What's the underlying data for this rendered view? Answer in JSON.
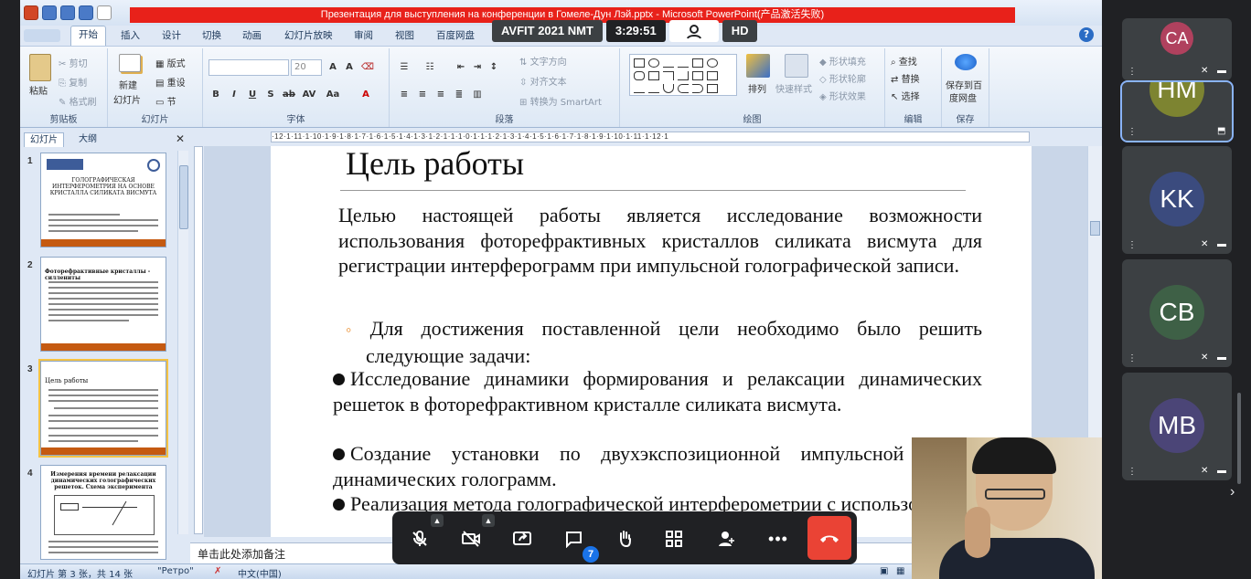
{
  "window": {
    "title": "Презентация для выступления на конференции в Гомеле-Дун Лэй.pptx - Microsoft PowerPoint(产品激活失败)"
  },
  "ribbon": {
    "tabs": [
      "开始",
      "插入",
      "设计",
      "切换",
      "动画",
      "幻灯片放映",
      "审阅",
      "视图",
      "百度网盘"
    ],
    "clipboard": {
      "paste": "粘贴",
      "cut": "剪切",
      "copy": "复制",
      "format_painter": "格式刷",
      "label": "剪贴板"
    },
    "slides": {
      "new_slide_1": "新建",
      "new_slide_2": "幻灯片",
      "layout": "版式",
      "reset": "重设",
      "section": "节",
      "label": "幻灯片"
    },
    "font": {
      "size": "20",
      "label": "字体"
    },
    "paragraph": {
      "text_direction": "文字方向",
      "align_text": "对齐文本",
      "smartart": "转换为 SmartArt",
      "label": "段落"
    },
    "drawing": {
      "arrange": "排列",
      "quick_styles": "快速样式",
      "shape_fill": "形状填充",
      "shape_outline": "形状轮廓",
      "shape_effects": "形状效果",
      "label": "绘图"
    },
    "editing": {
      "find": "查找",
      "replace": "替换",
      "select": "选择",
      "label": "编辑"
    },
    "save": {
      "save_1": "保存到百",
      "save_2": "度网盘",
      "label": "保存"
    }
  },
  "panel": {
    "tab_slides": "幻灯片",
    "tab_outline": "大纲",
    "thumbnails": [
      {
        "num": "1",
        "title": "ГОЛОГРАФИЧЕСКАЯ ИНТЕРФЕРОМЕТРИЯ НА ОСНОВЕ КРИСТАЛЛА СИЛИКАТА ВИСМУТА"
      },
      {
        "num": "2",
        "title": "Фоторефрактивные кристаллы - силлениты"
      },
      {
        "num": "3",
        "title": "Цель работы"
      },
      {
        "num": "4",
        "title": "Измерения времени релаксации динамических голографических решеток. Схема эксперимента"
      }
    ]
  },
  "ruler": {
    "text": "·12·1·11·1·10·1·9·1·8·1·7·1·6·1·5·1·4·1·3·1·2·1·1·1·0·1·1·1·2·1·3·1·4·1·5·1·6·1·7·1·8·1·9·1·10·1·11·1·12·1"
  },
  "slide": {
    "title": "Цель работы",
    "intro": "Целью настоящей работы является исследование возможности использования фоторефрактивных кристаллов силиката висмута для регистрации интерферограмм при импульсной голографической записи.",
    "sub": "Для достижения поставленной цели необходимо было решить следующие задачи:",
    "bullets": [
      "Исследование динамики формирования и релаксации динамических решеток в фоторефрактивном кристалле силиката висмута.",
      "Создание установки по двухэкспозиционной импульсной записи динамических голограмм.",
      "Реализация метода голографической интерферометрии с использованием"
    ]
  },
  "notes": {
    "placeholder": "单击此处添加备注"
  },
  "status": {
    "slide_count": "幻灯片 第 3 张，共 14 张",
    "theme": "\"Ретро\"",
    "language": "中文(中国)"
  },
  "meeting": {
    "name": "AVFIT 2021 NMT",
    "time": "3:29:51",
    "hd": "HD",
    "chat_count": "7"
  },
  "participants": [
    {
      "initials": "CA",
      "color": "#b0415e"
    },
    {
      "initials": "HM",
      "color": "#7d8431"
    },
    {
      "initials": "KK",
      "color": "#3b4b7e"
    },
    {
      "initials": "CB",
      "color": "#3e6046"
    },
    {
      "initials": "MB",
      "color": "#4b4577"
    }
  ]
}
